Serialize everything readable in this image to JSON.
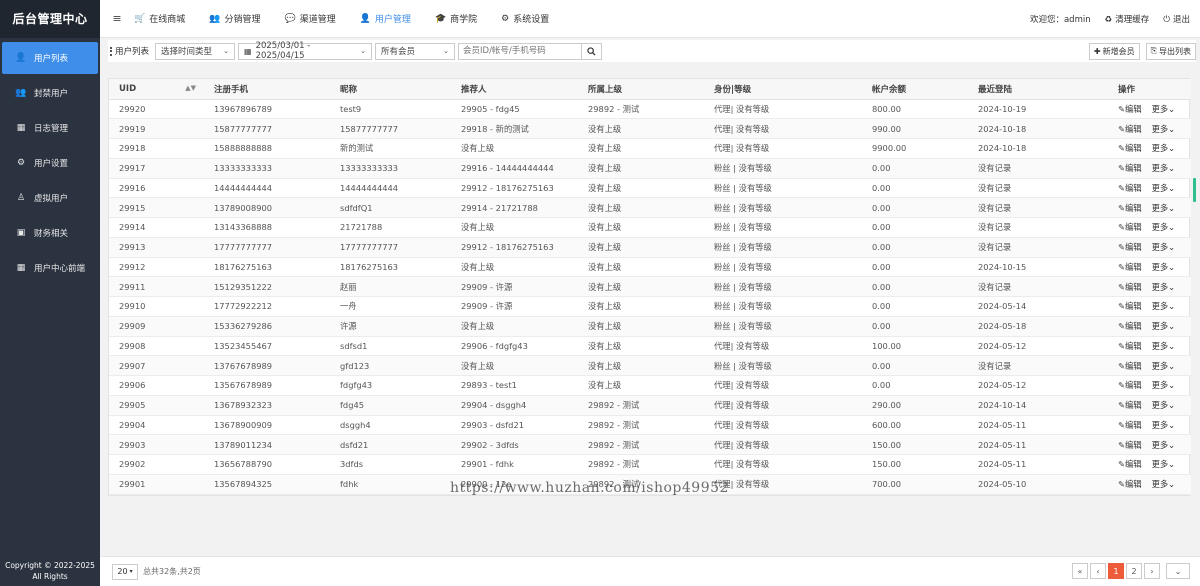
{
  "sidebar": {
    "brand": "后台管理中心",
    "items": [
      {
        "label": "用户列表",
        "icon": "user-icon",
        "glyph": "👤",
        "active": true
      },
      {
        "label": "封禁用户",
        "icon": "ban-user-icon",
        "glyph": "👥",
        "active": false
      },
      {
        "label": "日志管理",
        "icon": "calendar-icon",
        "glyph": "▦",
        "active": false
      },
      {
        "label": "用户设置",
        "icon": "gear-icon",
        "glyph": "⚙",
        "active": false
      },
      {
        "label": "虚拟用户",
        "icon": "user-outline-icon",
        "glyph": "♙",
        "active": false
      },
      {
        "label": "财务相关",
        "icon": "money-icon",
        "glyph": "▣",
        "active": false
      },
      {
        "label": "用户中心前端",
        "icon": "grid-icon",
        "glyph": "▦",
        "active": false
      }
    ],
    "copyright_line1": "Copyright © 2022-2025",
    "copyright_line2": "All Rights"
  },
  "topnav": {
    "menu_glyph": "≡",
    "items": [
      {
        "label": "在线商城",
        "icon": "cart-icon",
        "glyph": "🛒",
        "active": false
      },
      {
        "label": "分销管理",
        "icon": "users-icon",
        "glyph": "👥",
        "active": false
      },
      {
        "label": "渠道管理",
        "icon": "chat-icon",
        "glyph": "💬",
        "active": false
      },
      {
        "label": "用户管理",
        "icon": "user-icon",
        "glyph": "👤",
        "active": true
      },
      {
        "label": "商学院",
        "icon": "graduation-icon",
        "glyph": "🎓",
        "active": false
      },
      {
        "label": "系统设置",
        "icon": "gear-icon",
        "glyph": "⚙",
        "active": false
      }
    ],
    "welcome": "欢迎您：admin",
    "clear_cache": "清理缓存",
    "logout": "退出"
  },
  "toolbar": {
    "title": "用户列表",
    "time_type": "选择时间类型",
    "date_range": "2025/03/01 - 2025/04/15",
    "member_type": "所有会员",
    "search_placeholder": "会员ID/帐号/手机号码",
    "add_member": "新增会员",
    "export_list": "导出列表"
  },
  "table": {
    "headers": [
      "UID",
      "注册手机",
      "昵称",
      "推荐人",
      "所属上级",
      "身份|等级",
      "帐户余额",
      "最近登陆",
      "操作"
    ],
    "edit_label": "编辑",
    "more_label": "更多",
    "rows": [
      [
        "29920",
        "13967896789",
        "test9",
        "29905 - fdg45",
        "29892 - 测试",
        "代理| 没有等级",
        "800.00",
        "2024-10-19"
      ],
      [
        "29919",
        "15877777777",
        "15877777777",
        "29918 - 新的测试",
        "没有上级",
        "代理| 没有等级",
        "990.00",
        "2024-10-18"
      ],
      [
        "29918",
        "15888888888",
        "新的测试",
        "没有上级",
        "没有上级",
        "代理| 没有等级",
        "9900.00",
        "2024-10-18"
      ],
      [
        "29917",
        "13333333333",
        "13333333333",
        "29916 - 14444444444",
        "没有上级",
        "粉丝 | 没有等级",
        "0.00",
        "没有记录"
      ],
      [
        "29916",
        "14444444444",
        "14444444444",
        "29912 - 18176275163",
        "没有上级",
        "粉丝 | 没有等级",
        "0.00",
        "没有记录"
      ],
      [
        "29915",
        "13789008900",
        "sdfdfQ1",
        "29914 - 21721788",
        "没有上级",
        "粉丝 | 没有等级",
        "0.00",
        "没有记录"
      ],
      [
        "29914",
        "13143368888",
        "21721788",
        "没有上级",
        "没有上级",
        "粉丝 | 没有等级",
        "0.00",
        "没有记录"
      ],
      [
        "29913",
        "17777777777",
        "17777777777",
        "29912 - 18176275163",
        "没有上级",
        "粉丝 | 没有等级",
        "0.00",
        "没有记录"
      ],
      [
        "29912",
        "18176275163",
        "18176275163",
        "没有上级",
        "没有上级",
        "粉丝 | 没有等级",
        "0.00",
        "2024-10-15"
      ],
      [
        "29911",
        "15129351222",
        "赵丽",
        "29909 - 许源",
        "没有上级",
        "粉丝 | 没有等级",
        "0.00",
        "没有记录"
      ],
      [
        "29910",
        "17772922212",
        "一舟",
        "29909 - 许源",
        "没有上级",
        "粉丝 | 没有等级",
        "0.00",
        "2024-05-14"
      ],
      [
        "29909",
        "15336279286",
        "许源",
        "没有上级",
        "没有上级",
        "粉丝 | 没有等级",
        "0.00",
        "2024-05-18"
      ],
      [
        "29908",
        "13523455467",
        "sdfsd1",
        "29906 - fdgfg43",
        "没有上级",
        "代理| 没有等级",
        "100.00",
        "2024-05-12"
      ],
      [
        "29907",
        "13767678989",
        "gfd123",
        "没有上级",
        "没有上级",
        "粉丝 | 没有等级",
        "0.00",
        "没有记录"
      ],
      [
        "29906",
        "13567678989",
        "fdgfg43",
        "29893 - test1",
        "没有上级",
        "代理| 没有等级",
        "0.00",
        "2024-05-12"
      ],
      [
        "29905",
        "13678932323",
        "fdg45",
        "29904 - dsggh4",
        "29892 - 测试",
        "代理| 没有等级",
        "290.00",
        "2024-10-14"
      ],
      [
        "29904",
        "13678900909",
        "dsggh4",
        "29903 - dsfd21",
        "29892 - 测试",
        "代理| 没有等级",
        "600.00",
        "2024-05-11"
      ],
      [
        "29903",
        "13789011234",
        "dsfd21",
        "29902 - 3dfds",
        "29892 - 测试",
        "代理| 没有等级",
        "150.00",
        "2024-05-11"
      ],
      [
        "29902",
        "13656788790",
        "3dfds",
        "29901 - fdhk",
        "29892 - 测试",
        "代理| 没有等级",
        "150.00",
        "2024-05-11"
      ],
      [
        "29901",
        "13567894325",
        "fdhk",
        "29900 - 12e",
        "29892 - 测试",
        "代理| 没有等级",
        "700.00",
        "2024-05-10"
      ]
    ]
  },
  "watermark": "https://www.huzhan.com/ishop49952",
  "footer": {
    "page_size": "20",
    "total_text": "总共32条,共2页",
    "pages": [
      "1",
      "2"
    ],
    "prev_first": "«",
    "prev": "‹",
    "next": "›",
    "next_last": "»"
  },
  "colors": {
    "sidebar_bg": "#2b3340",
    "accent": "#3f8ee9",
    "pager_active": "#ee5b3a"
  }
}
